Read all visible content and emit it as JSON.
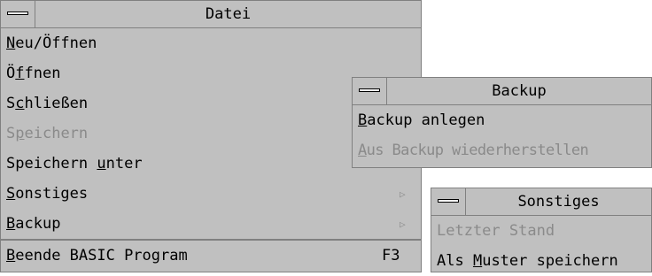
{
  "datei_menu": {
    "title": "Datei",
    "items": [
      {
        "pre": "",
        "u": "N",
        "post": "eu/Öffnen"
      },
      {
        "pre": "Ö",
        "u": "f",
        "post": "fnen"
      },
      {
        "pre": "S",
        "u": "c",
        "post": "hließen"
      },
      {
        "pre": "S",
        "u": "p",
        "post": "eichern"
      },
      {
        "pre": "Speichern ",
        "u": "u",
        "post": "nter"
      },
      {
        "pre": "",
        "u": "S",
        "post": "onstiges",
        "arrow": "▷"
      },
      {
        "pre": "",
        "u": "B",
        "post": "ackup",
        "arrow": "▷"
      }
    ],
    "exit": {
      "pre": "",
      "u": "B",
      "post": "eende BASIC Program",
      "accel": "F3"
    }
  },
  "backup_menu": {
    "title": "Backup",
    "items": [
      {
        "pre": "",
        "u": "B",
        "post": "ackup anlegen"
      },
      {
        "pre": "",
        "u": "A",
        "post": "us Backup wiederherstellen"
      }
    ]
  },
  "sonstiges_menu": {
    "title": "Sonstiges",
    "items": [
      {
        "pre": "Letzter Stand",
        "u": "",
        "post": ""
      },
      {
        "pre": "Als ",
        "u": "M",
        "post": "uster speichern"
      }
    ]
  }
}
